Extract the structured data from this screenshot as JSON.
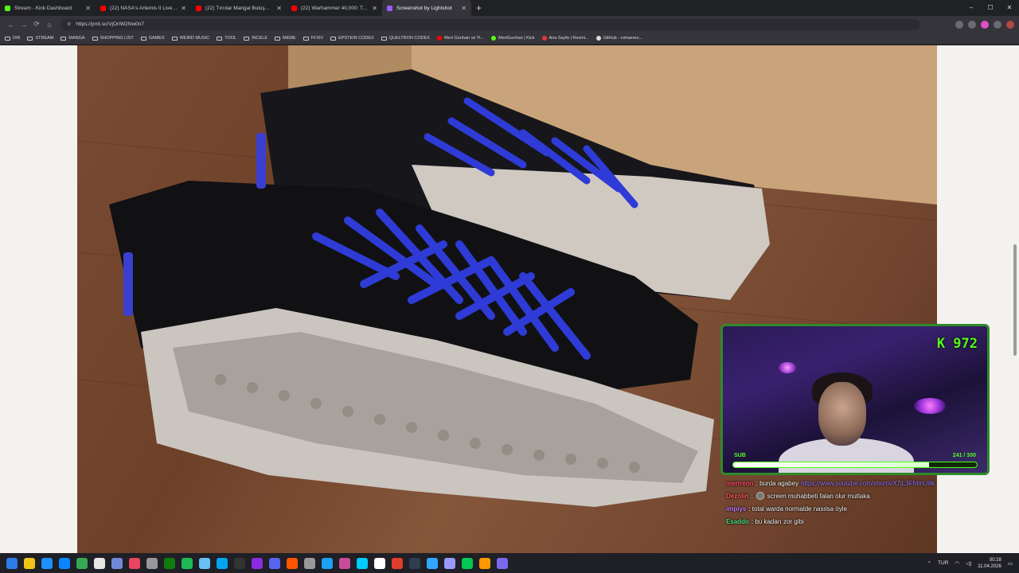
{
  "tabs": [
    {
      "title": "Stream - Kick Dashboard",
      "favicon_color": "#53fc18",
      "active": false
    },
    {
      "title": "(22) NASA's Artemis II Live Views f",
      "favicon_color": "#ff0000",
      "active": false
    },
    {
      "title": "(22) Tırcılar Mangal Buluşması Ver",
      "favicon_color": "#ff0000",
      "active": false
    },
    {
      "title": "(22) Warhammer 40,000: Total Wa",
      "favicon_color": "#ff0000",
      "active": false
    },
    {
      "title": "Screenshot by Lightshot",
      "favicon_color": "#9c5cff",
      "active": true
    }
  ],
  "new_tab_label": "+",
  "window_controls": {
    "minimize": "–",
    "maximize": "☐",
    "close": "✕"
  },
  "address": {
    "url": "https://prnt.sc/VjOrIW2Nw0n7"
  },
  "nav": {
    "back": "←",
    "forward": "→",
    "reload": "⟳",
    "home": "⌂"
  },
  "bookmarks": [
    {
      "label": "DIR",
      "type": "folder"
    },
    {
      "label": "STREAM",
      "type": "folder"
    },
    {
      "label": "MANGA",
      "type": "folder"
    },
    {
      "label": "SHOPPING LIST",
      "type": "folder"
    },
    {
      "label": "GAMES",
      "type": "folder"
    },
    {
      "label": "WEIRD MUSIC",
      "type": "folder"
    },
    {
      "label": "TOOL",
      "type": "folder"
    },
    {
      "label": "INCELE",
      "type": "folder"
    },
    {
      "label": "MEME",
      "type": "folder"
    },
    {
      "label": "FFXIV",
      "type": "folder"
    },
    {
      "label": "EPSTEIN CODEX",
      "type": "folder"
    },
    {
      "label": "QUELTRON CODEX",
      "type": "folder"
    },
    {
      "label": "Mert Günhan ve Yi...",
      "type": "site",
      "color": "#ff0000"
    },
    {
      "label": "MertGunhan | Kick",
      "type": "site",
      "color": "#53fc18"
    },
    {
      "label": "Ana Sayfa | Resmi...",
      "type": "site",
      "color": "#e33"
    },
    {
      "label": "GitHub - cohaereo...",
      "type": "site",
      "color": "#ddd"
    }
  ],
  "stream": {
    "kick_count": "K 972",
    "sub_label": "SUB",
    "sub_count": "241 / 300",
    "sub_progress": 0.803
  },
  "chat": [
    {
      "user": "mertreon",
      "user_color": "#ff4d6d",
      "text": "burda agabey",
      "link": "https://www.youtube.com/shorts/X7jL3FMmU8k"
    },
    {
      "user": "Dezolin",
      "user_color": "#ff5c5c",
      "text": "screen muhabbeti falan olur mutlaka",
      "emote": true
    },
    {
      "user": "impiys",
      "user_color": "#c77dff",
      "text": "total warda normalde nasılsa öyle"
    },
    {
      "user": "Esaddo",
      "user_color": "#4ade80",
      "text": "bu kadarı zor gibi"
    }
  ],
  "taskbar": {
    "apps": [
      "#2b7de9",
      "#f0c419",
      "#1e90ff",
      "#0a84ff",
      "#34a853",
      "#e6e6e6",
      "#7289da",
      "#e94560",
      "#999",
      "#107c10",
      "#1db954",
      "#66c0f4",
      "#00a4ef",
      "#333",
      "#8a2be2",
      "#5865f2",
      "#ff5500",
      "#999",
      "#1da1f2",
      "#c94c9b",
      "#00ccff",
      "#ffffff",
      "#e03e2d",
      "#2c3e50",
      "#31a8ff",
      "#9999ff",
      "#00c853",
      "#ff9800",
      "#7b68ee"
    ],
    "language": "TUR",
    "time": "00:28",
    "date": "11.04.2026"
  }
}
